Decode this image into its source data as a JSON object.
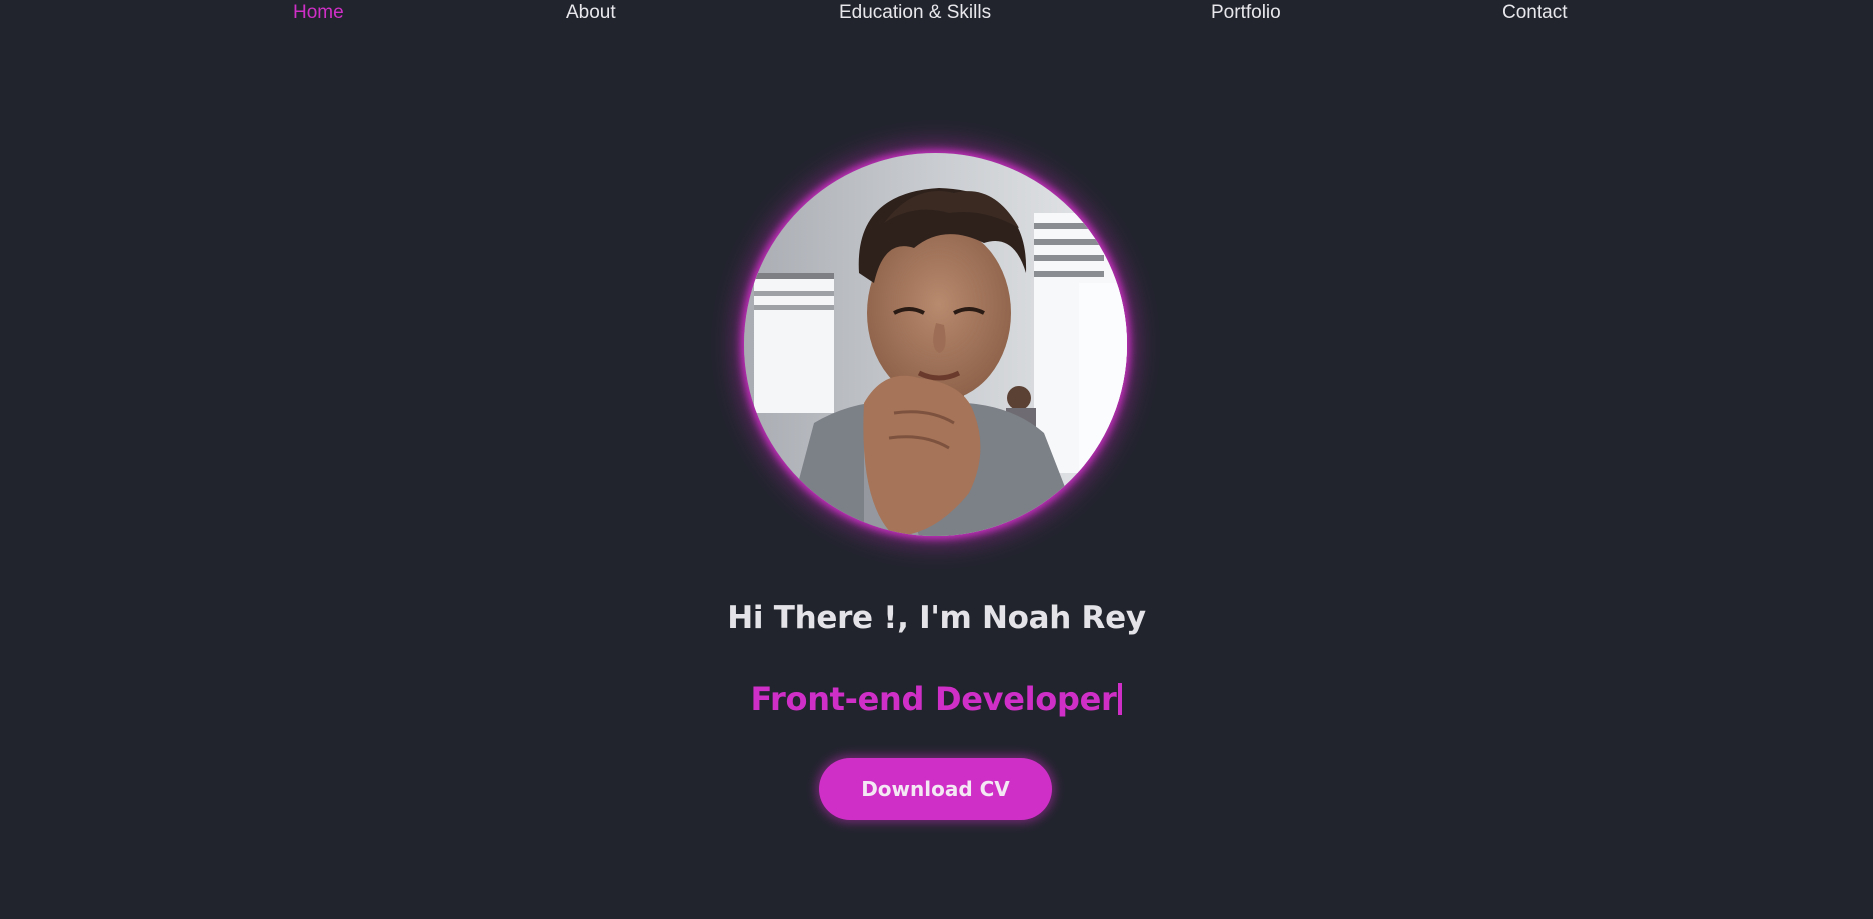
{
  "nav": {
    "items": [
      {
        "label": "Home",
        "active": true
      },
      {
        "label": "About",
        "active": false
      },
      {
        "label": "Education & Skills",
        "active": false
      },
      {
        "label": "Portfolio",
        "active": false
      },
      {
        "label": "Contact",
        "active": false
      }
    ]
  },
  "hero": {
    "greeting": "Hi There !, I'm Noah Rey",
    "role": "Front-end Developer",
    "cta_label": "Download CV",
    "avatar_icon": "profile-photo"
  },
  "colors": {
    "background": "#21242d",
    "accent": "#cf2fc6",
    "text": "#e8e8ec"
  }
}
